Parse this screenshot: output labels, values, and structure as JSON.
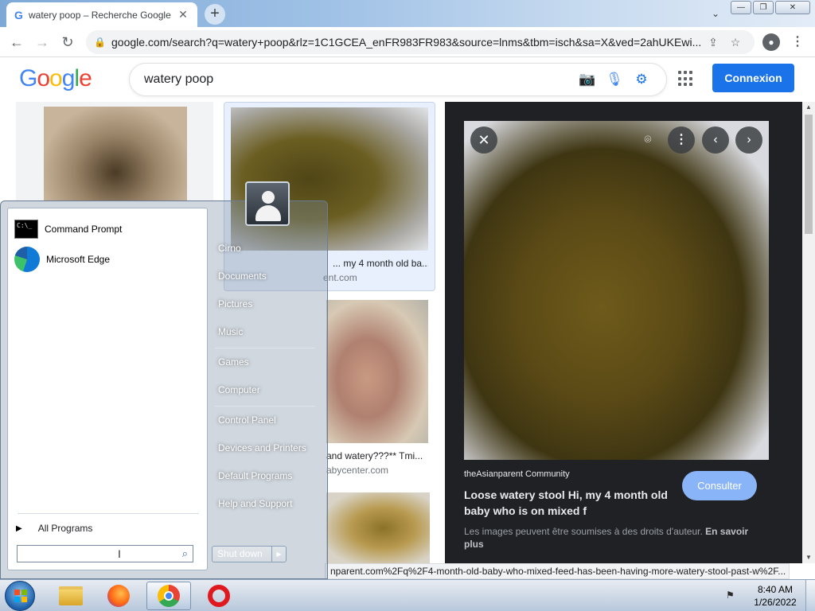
{
  "browser": {
    "tab_title": "watery poop – Recherche Google",
    "tab_favicon": "G",
    "tab_close": "✕",
    "new_tab": "+",
    "tab_search": "⌄",
    "window_minimize": "—",
    "window_restore": "❐",
    "window_close": "✕",
    "back": "←",
    "forward": "→",
    "reload": "↻",
    "lock": "🔒",
    "url": "google.com/search?q=watery+poop&rlz=1C1GCEA_enFR983FR983&source=lnms&tbm=isch&sa=X&ved=2ahUKEwi...",
    "share": "⇪",
    "bookmark": "☆",
    "menu": "⋮"
  },
  "google": {
    "logo": [
      "G",
      "o",
      "o",
      "g",
      "l",
      "e"
    ],
    "query": "watery poop",
    "camera": "📷",
    "mic": "🎙",
    "settings": "⚙",
    "sign_in": "Connexion"
  },
  "results": [
    {
      "title": "",
      "source": ""
    },
    {
      "title": "... my 4 month old ba...",
      "source": "ent.com"
    },
    {
      "title": "and watery???** Tmi...",
      "source": "abycenter.com"
    }
  ],
  "preview": {
    "close": "✕",
    "lens": "⌾",
    "more": "⋮",
    "prev": "‹",
    "next": "›",
    "source": "theAsianparent Community",
    "title": "Loose watery stool Hi, my 4 month old baby who is on mixed f",
    "visit": "Consulter",
    "note": "Les images peuvent être soumises à des droits d'auteur.",
    "learn_more": "En savoir plus"
  },
  "status_url": "nparent.com%2Fq%2F4-month-old-baby-who-mixed-feed-has-been-having-more-watery-stool-past-w%2F...",
  "start_menu": {
    "pinned": [
      {
        "label": "Command Prompt",
        "icon": "command-prompt-icon"
      },
      {
        "label": "Microsoft Edge",
        "icon": "edge-icon"
      }
    ],
    "all_programs": "All Programs",
    "search_cursor": "I",
    "search_icon": "⌕",
    "right": {
      "user": "Cirno",
      "documents": "Documents",
      "pictures": "Pictures",
      "music": "Music",
      "games": "Games",
      "computer": "Computer",
      "control_panel": "Control Panel",
      "devices": "Devices and Printers",
      "default_programs": "Default Programs",
      "help": "Help and Support"
    },
    "shutdown": "Shut down",
    "shutdown_arrow": "▶"
  },
  "taskbar": {
    "apps": [
      "file-explorer",
      "firefox",
      "chrome",
      "opera"
    ],
    "active": "chrome",
    "time": "8:40 AM",
    "date": "1/26/2022"
  },
  "colors": {
    "google_blue": "#1a73e8",
    "preview_bg": "#202124",
    "visit_button": "#8ab4f8"
  }
}
